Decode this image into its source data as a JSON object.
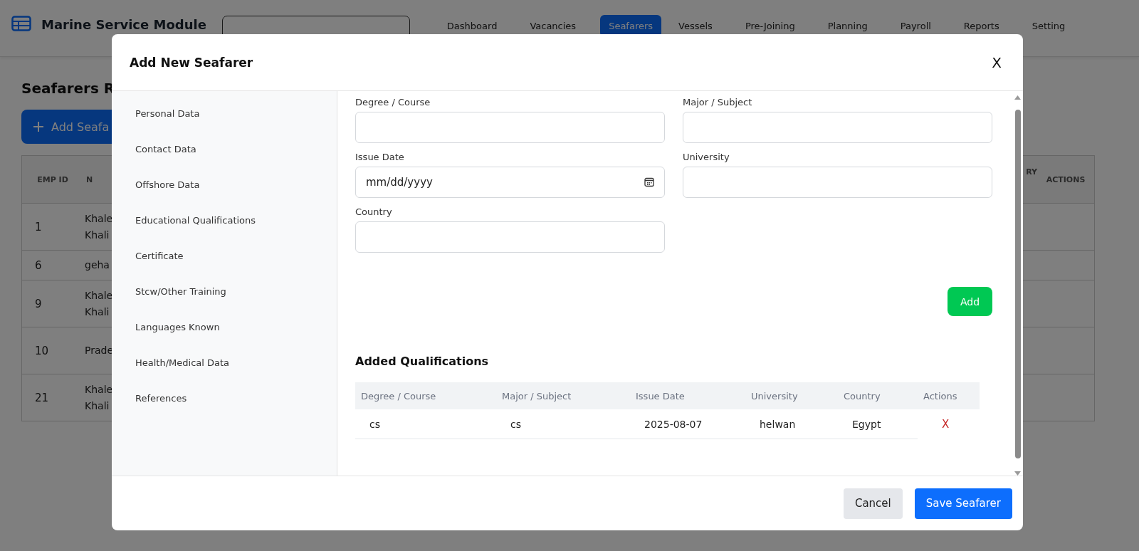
{
  "app": {
    "title": "Marine Service Module",
    "nav": [
      {
        "label": "Dashboard",
        "selected": false
      },
      {
        "label": "Vacancies",
        "selected": false
      },
      {
        "label": "Seafarers",
        "selected": true
      },
      {
        "label": "Vessels",
        "selected": false
      },
      {
        "label": "Pre-Joining",
        "selected": false
      },
      {
        "label": "Planning",
        "selected": false
      },
      {
        "label": "Payroll",
        "selected": false
      },
      {
        "label": "Reports",
        "selected": false
      },
      {
        "label": "Setting",
        "selected": false
      }
    ]
  },
  "page": {
    "heading": "Seafarers R",
    "add_button": "Add Seafa",
    "table": {
      "columns": [
        "EMP ID",
        "N",
        "RY",
        "ACTIONS"
      ],
      "rows": [
        {
          "emp_id": "1",
          "name": "Khale Khali"
        },
        {
          "emp_id": "6",
          "name": "geha"
        },
        {
          "emp_id": "9",
          "name": "Khale Khali"
        },
        {
          "emp_id": "10",
          "name": "Prade"
        },
        {
          "emp_id": "21",
          "name": "Khale Khali"
        }
      ]
    }
  },
  "modal": {
    "title": "Add New Seafarer",
    "close": "X",
    "sections": [
      {
        "label": "Personal Data",
        "selected": false
      },
      {
        "label": "Contact Data",
        "selected": false
      },
      {
        "label": "Offshore Data",
        "selected": false
      },
      {
        "label": "Educational Qualifications",
        "selected": false
      },
      {
        "label": "Certificate",
        "selected": false
      },
      {
        "label": "Stcw/Other Training",
        "selected": false
      },
      {
        "label": "Languages Known",
        "selected": false
      },
      {
        "label": "Health/Medical Data",
        "selected": false
      },
      {
        "label": "References",
        "selected": false
      }
    ],
    "fields": [
      {
        "label": "Degree / Course",
        "kind": "text"
      },
      {
        "label": "Major / Subject",
        "kind": "text"
      },
      {
        "label": "Issue Date",
        "kind": "date",
        "placeholder": "mm/dd/yyyy"
      },
      {
        "label": "University",
        "kind": "text"
      },
      {
        "label": "Country",
        "kind": "text"
      }
    ],
    "add_button": "Add",
    "list_title": "Added Qualifications",
    "table": {
      "columns": [
        "Degree / Course",
        "Major / Subject",
        "Issue Date",
        "University",
        "Country",
        "Actions"
      ],
      "rows": [
        {
          "cells": [
            "cs",
            "cs",
            "2025-08-07",
            "helwan",
            "Egypt"
          ],
          "delete": "X"
        }
      ]
    },
    "buttons": {
      "cancel": "Cancel",
      "save": "Save Seafarer"
    }
  }
}
